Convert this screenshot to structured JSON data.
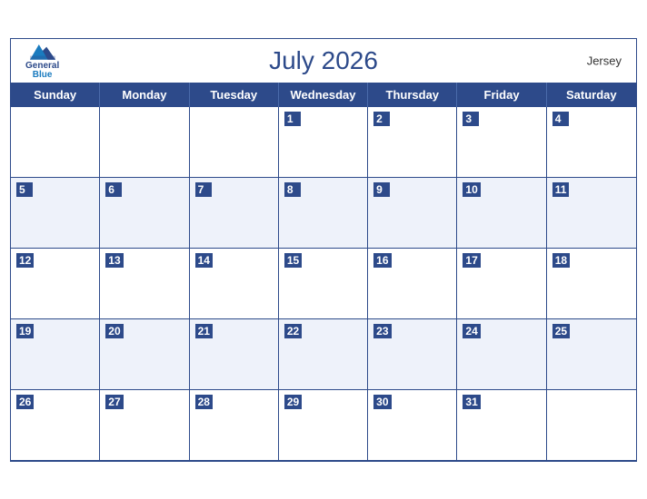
{
  "calendar": {
    "title": "July 2026",
    "region": "Jersey",
    "days": [
      "Sunday",
      "Monday",
      "Tuesday",
      "Wednesday",
      "Thursday",
      "Friday",
      "Saturday"
    ],
    "weeks": [
      [
        "",
        "",
        "",
        "1",
        "2",
        "3",
        "4"
      ],
      [
        "5",
        "6",
        "7",
        "8",
        "9",
        "10",
        "11"
      ],
      [
        "12",
        "13",
        "14",
        "15",
        "16",
        "17",
        "18"
      ],
      [
        "19",
        "20",
        "21",
        "22",
        "23",
        "24",
        "25"
      ],
      [
        "26",
        "27",
        "28",
        "29",
        "30",
        "31",
        ""
      ]
    ]
  },
  "logo": {
    "general": "General",
    "blue": "Blue"
  }
}
